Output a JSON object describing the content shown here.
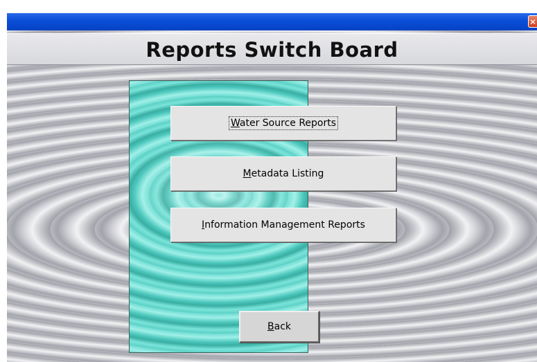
{
  "window": {
    "close_glyph": "✕"
  },
  "header": {
    "title": "Reports Switch Board"
  },
  "buttons": {
    "water_source": {
      "accel": "W",
      "rest": "ater Source Reports"
    },
    "metadata": {
      "accel": "M",
      "rest": "etadata Listing"
    },
    "info_mgmt": {
      "accel": "I",
      "rest": "nformation Management Reports"
    },
    "back": {
      "accel": "B",
      "rest": "ack"
    }
  },
  "colors": {
    "titlebar_blue": "#0a4fd8",
    "panel_teal": "#5ccfc4",
    "button_face": "#e4e4e4"
  }
}
